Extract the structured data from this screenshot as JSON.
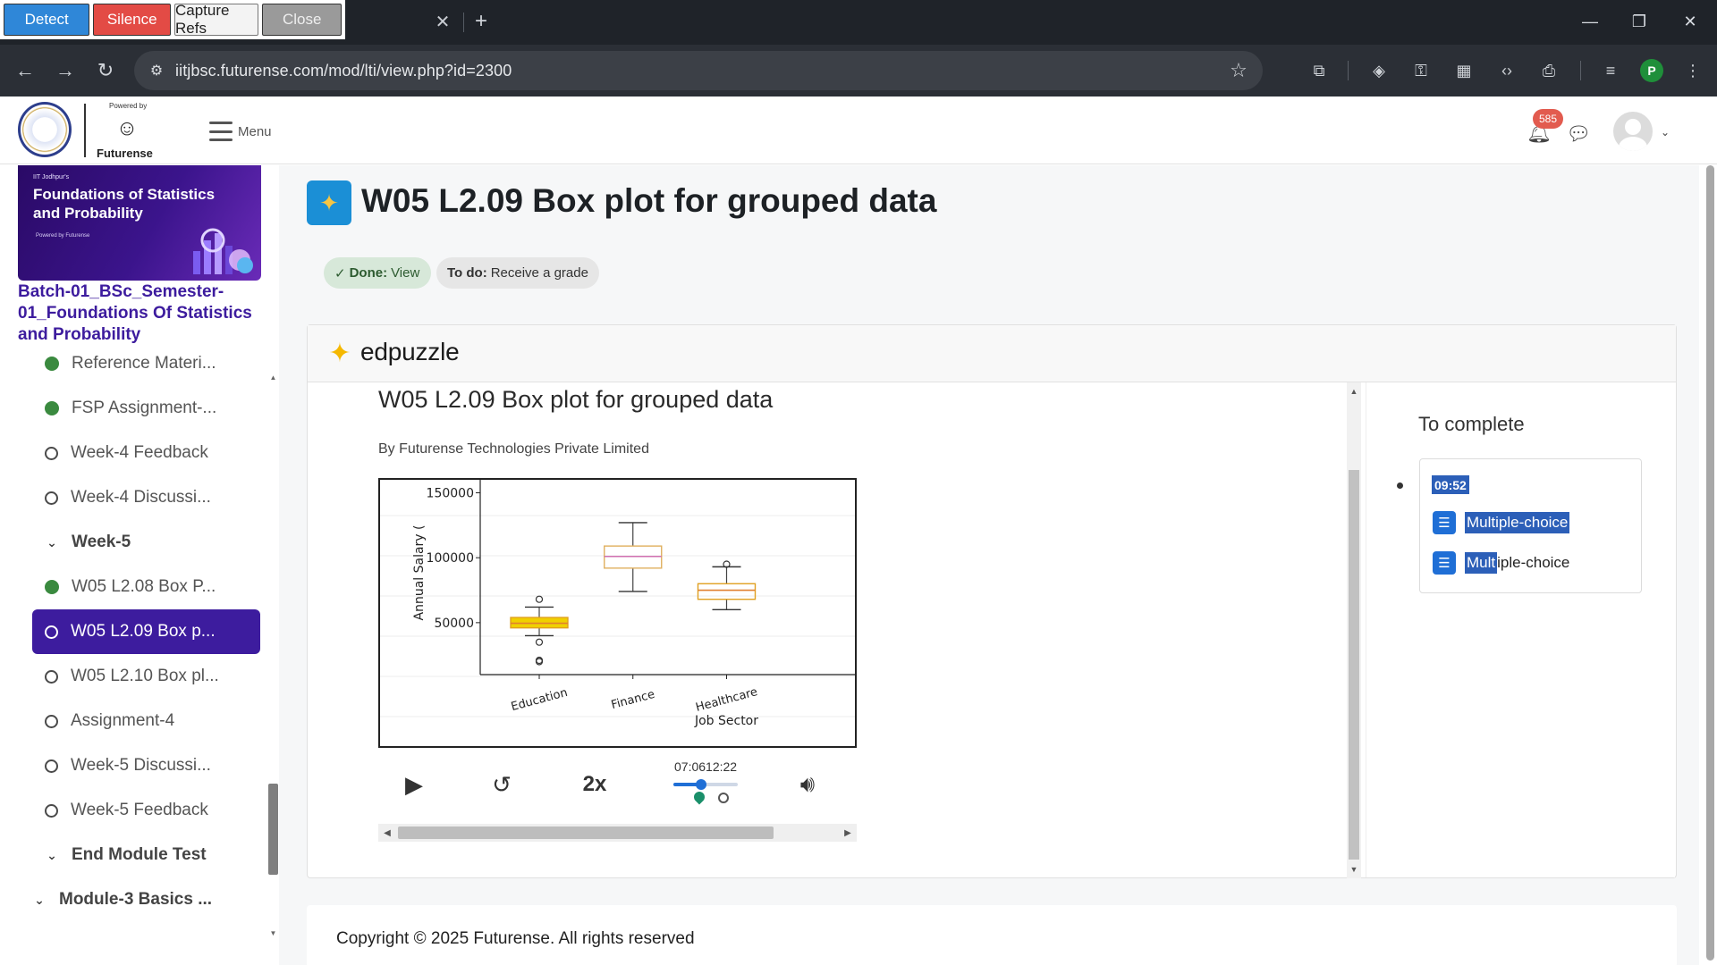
{
  "extension": {
    "detect": "Detect",
    "silence": "Silence",
    "capture": "Capture Refs",
    "close": "Close"
  },
  "browser": {
    "url": "iitjbsc.futurense.com/mod/lti/view.php?id=2300",
    "profile_initial": "P",
    "icons": [
      "back-icon",
      "forward-icon",
      "reload-icon",
      "site-info-icon",
      "star-icon",
      "extensions-icon",
      "incognito-icon",
      "password-key-icon",
      "tab-search-icon",
      "devtools-icon",
      "print-icon",
      "media-icon"
    ]
  },
  "header": {
    "powered_by": "Powered by",
    "brand": "Futurense",
    "menu_label": "Menu",
    "notification_count": "585"
  },
  "sidebar": {
    "banner_small": "IIT Jodhpur's",
    "banner_title": "Foundations of Statistics and Probability",
    "banner_powered": "Powered by Futurense",
    "course_name": "Batch-01_BSc_Semester-01_Foundations Of Statistics and Probability",
    "items": [
      {
        "label": "Reference Materi...",
        "status": "done"
      },
      {
        "label": "FSP Assignment-...",
        "status": "done"
      },
      {
        "label": "Week-4 Feedback",
        "status": "todo"
      },
      {
        "label": "Week-4 Discussi...",
        "status": "todo"
      },
      {
        "label": "Week-5",
        "status": "section"
      },
      {
        "label": "W05 L2.08 Box P...",
        "status": "done"
      },
      {
        "label": "W05 L2.09 Box p...",
        "status": "active"
      },
      {
        "label": "W05 L2.10 Box pl...",
        "status": "todo"
      },
      {
        "label": "Assignment-4",
        "status": "todo"
      },
      {
        "label": "Week-5 Discussi...",
        "status": "todo"
      },
      {
        "label": "Week-5 Feedback",
        "status": "todo"
      },
      {
        "label": "End Module Test",
        "status": "section"
      },
      {
        "label": "Module-3 Basics ...",
        "status": "module"
      }
    ]
  },
  "main": {
    "title": "W05 L2.09 Box plot for grouped data",
    "done_label": "Done:",
    "done_value": "View",
    "todo_label": "To do:",
    "todo_value": "Receive a grade",
    "edpuzzle_brand": "edpuzzle",
    "video_title": "W05 L2.09 Box plot for grouped data",
    "video_by": "By Futurense Technologies Private Limited",
    "controls": {
      "speed": "2x",
      "time": "07:0612:22",
      "progress_fraction": 0.43
    },
    "to_complete": {
      "title": "To complete",
      "time": "09:52",
      "q1_highlight": "Multiple-choice",
      "q1_rest": "",
      "q2_highlight": "Mult",
      "q2_rest": "iple-choice"
    },
    "footer": "Copyright © 2025 Futurense. All rights reserved"
  },
  "chart_data": {
    "type": "box",
    "categories": [
      "Education",
      "Finance",
      "Healthcare"
    ],
    "xlabel": "Job Sector",
    "ylabel": "Annual Salary (",
    "yticks": [
      50000,
      100000,
      150000
    ],
    "ylim": [
      10000,
      160000
    ],
    "boxes": [
      {
        "category": "Education",
        "min": 40000,
        "q1": 46000,
        "median": 49500,
        "q3": 54000,
        "max": 62000,
        "outliers": [
          35000,
          21000,
          20000,
          68000
        ],
        "color": "#f0d000"
      },
      {
        "category": "Finance",
        "min": 74000,
        "q1": 92000,
        "median": 101000,
        "q3": 109000,
        "max": 127000,
        "outliers": [],
        "color": "#e8a2c8"
      },
      {
        "category": "Healthcare",
        "min": 60000,
        "q1": 68000,
        "median": 75000,
        "q3": 80000,
        "max": 93000,
        "outliers": [
          95000
        ],
        "color": "#f0a040"
      }
    ]
  }
}
